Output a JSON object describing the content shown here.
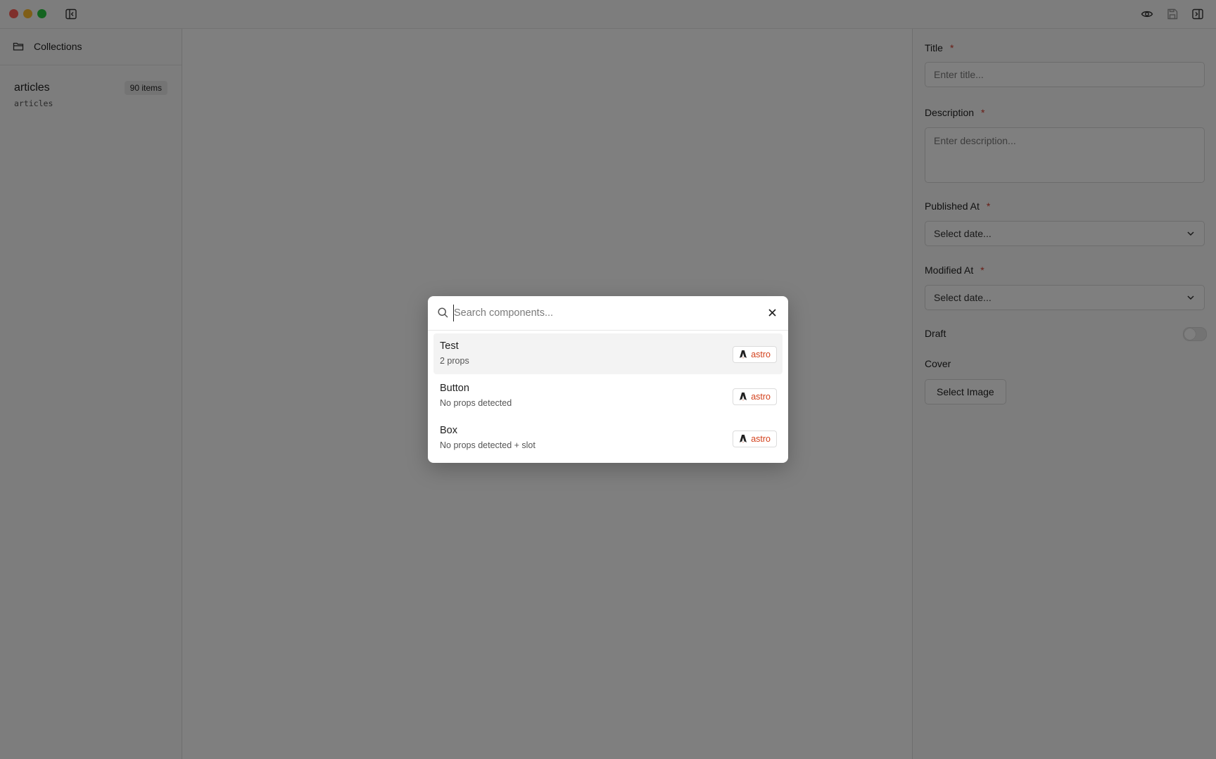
{
  "sidebar": {
    "header_label": "Collections",
    "collection": {
      "name": "articles",
      "slug": "articles",
      "badge": "90 items"
    }
  },
  "form": {
    "title_label": "Title",
    "title_placeholder": "Enter title...",
    "description_label": "Description",
    "description_placeholder": "Enter description...",
    "published_label": "Published At",
    "published_value": "Select date...",
    "modified_label": "Modified At",
    "modified_value": "Select date...",
    "draft_label": "Draft",
    "draft_on": false,
    "cover_label": "Cover",
    "select_image_label": "Select Image",
    "required_mark": "*"
  },
  "search": {
    "placeholder": "Search components...",
    "results": [
      {
        "name": "Test",
        "sub": "2 props",
        "badge": "astro",
        "selected": true
      },
      {
        "name": "Button",
        "sub": "No props detected",
        "badge": "astro",
        "selected": false
      },
      {
        "name": "Box",
        "sub": "No props detected + slot",
        "badge": "astro",
        "selected": false
      }
    ]
  },
  "colors": {
    "accent_required": "#d33a2c",
    "astro_badge_text": "#d3411c",
    "overlay": "rgba(0,0,0,0.5)"
  },
  "icons": {
    "titlebar_left": "sidebar-collapse-icon",
    "titlebar_right": [
      "eye-icon",
      "save-icon",
      "panel-right-icon"
    ],
    "search": "search-icon",
    "close": "close-icon",
    "folder": "folder-icon",
    "astro": "astro-logo-icon"
  }
}
